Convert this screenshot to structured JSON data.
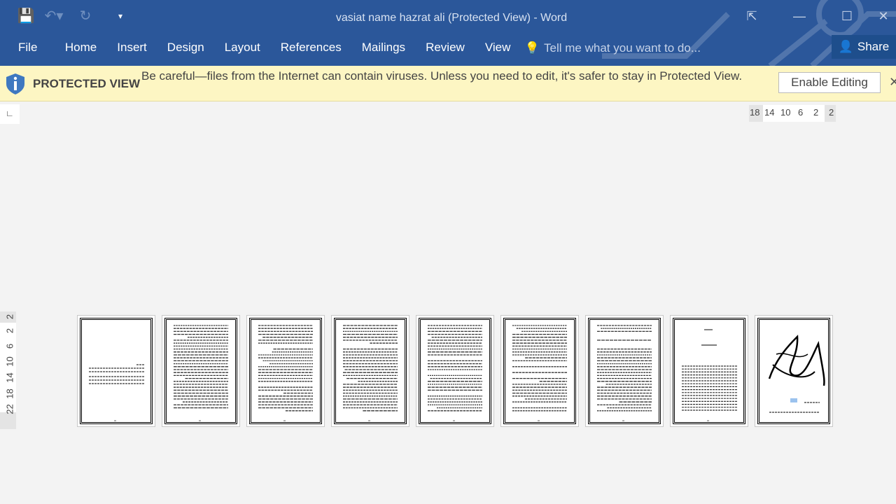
{
  "window": {
    "title": "vasiat name hazrat ali (Protected View) - Word"
  },
  "qat": {
    "icons": [
      "save-icon",
      "undo-icon",
      "redo-icon",
      "customize-icon"
    ]
  },
  "ribbon": {
    "tabs": [
      "File",
      "Home",
      "Insert",
      "Design",
      "Layout",
      "References",
      "Mailings",
      "Review",
      "View"
    ],
    "tell_me": "Tell me what you want to do...",
    "share": "Share"
  },
  "protected_bar": {
    "label": "PROTECTED VIEW",
    "message": "Be careful—files from the Internet can contain viruses. Unless you need to edit, it's safer to stay in Protected View.",
    "enable_button": "Enable Editing",
    "close": "✕"
  },
  "ruler": {
    "tab_selector": "∟",
    "horizontal": [
      "18",
      "14",
      "10",
      "6",
      "2",
      "2"
    ],
    "vertical": [
      "2",
      "2",
      "6",
      "10",
      "14",
      "18",
      "22"
    ]
  },
  "pages": [
    "sparse",
    "dense",
    "dense",
    "dense",
    "dense",
    "dense",
    "dense",
    "title",
    "calligraphy"
  ],
  "colors": {
    "ribbon": "#2b579a",
    "bar": "#fdf6c3"
  }
}
